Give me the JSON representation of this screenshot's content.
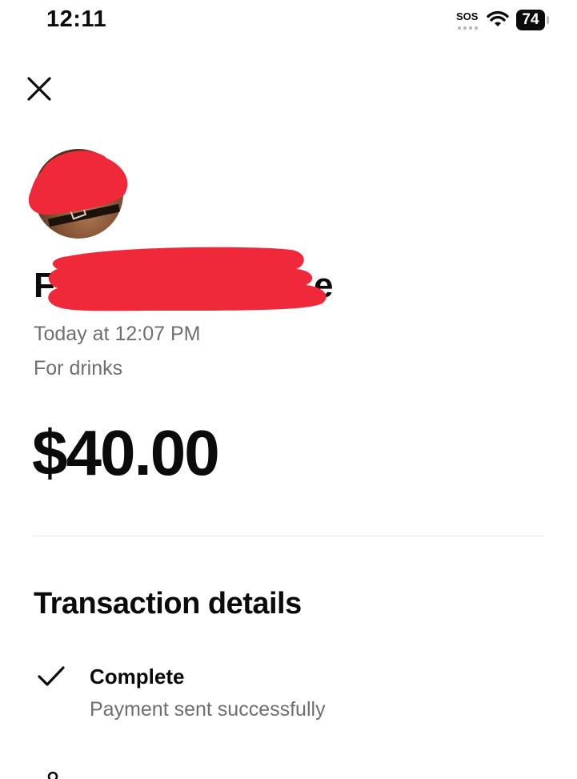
{
  "status_bar": {
    "time": "12:11",
    "sos": "SOS",
    "battery": "74"
  },
  "icons": {
    "close": "close-icon",
    "check": "checkmark-icon",
    "person": "person-icon",
    "wifi": "wifi-icon"
  },
  "recipient": {
    "name_initial": "F",
    "name_tail": "e"
  },
  "transaction": {
    "timestamp": "Today at 12:07 PM",
    "note": "For drinks",
    "amount": "$40.00"
  },
  "details": {
    "title": "Transaction details",
    "status_title": "Complete",
    "status_subtitle": "Payment sent successfully"
  },
  "colors": {
    "redaction": "#f0293a",
    "secondary_text": "#6f6f6f"
  }
}
